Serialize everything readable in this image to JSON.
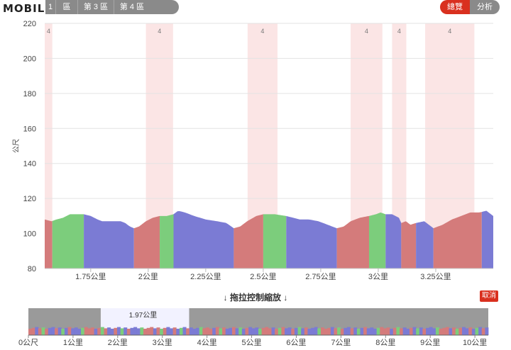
{
  "header": {
    "logo_text": "MOBILE",
    "logo_icon": "smiley-face-icon",
    "zone_tabs": [
      {
        "label": "1",
        "width": 14
      },
      {
        "label": "區",
        "width": 30
      },
      {
        "label": "第 3 區",
        "width": 50
      },
      {
        "label": "第 4 區",
        "width": 50
      }
    ],
    "view_toggle": {
      "overview_label": "總覽",
      "analysis_label": "分析",
      "active": "overview"
    }
  },
  "chart_data": [
    {
      "type": "area",
      "ylabel": "公尺",
      "ylim": [
        80,
        220
      ],
      "xlim": [
        1.55,
        3.5
      ],
      "y_ticks": [
        80,
        100,
        120,
        140,
        160,
        180,
        200,
        220
      ],
      "x_ticks": [
        1.75,
        2.0,
        2.25,
        2.5,
        2.75,
        3.0,
        3.25
      ],
      "x_tick_labels": [
        "1.75公里",
        "2公里",
        "2.25公里",
        "2.5公里",
        "2.75公里",
        "3公里",
        "3.25公里"
      ],
      "grid": true,
      "colors": {
        "red": "#d47b7b",
        "green": "#7ccd7c",
        "blue": "#7b7bd4"
      },
      "zone_bands": [
        {
          "x0": 1.55,
          "x1": 1.583,
          "label": "4"
        },
        {
          "x0": 1.99,
          "x1": 2.108,
          "label": "4"
        },
        {
          "x0": 2.432,
          "x1": 2.562,
          "label": "4"
        },
        {
          "x0": 2.88,
          "x1": 3.018,
          "label": "4"
        },
        {
          "x0": 3.06,
          "x1": 3.122,
          "label": "4"
        },
        {
          "x0": 3.204,
          "x1": 3.418,
          "label": "4"
        }
      ],
      "segments": [
        {
          "x0": 1.55,
          "x1": 1.583,
          "color": "red"
        },
        {
          "x0": 1.583,
          "x1": 1.72,
          "color": "green"
        },
        {
          "x0": 1.72,
          "x1": 1.938,
          "color": "blue"
        },
        {
          "x0": 1.938,
          "x1": 2.05,
          "color": "red"
        },
        {
          "x0": 2.05,
          "x1": 2.11,
          "color": "green"
        },
        {
          "x0": 2.11,
          "x1": 2.372,
          "color": "blue"
        },
        {
          "x0": 2.372,
          "x1": 2.5,
          "color": "red"
        },
        {
          "x0": 2.5,
          "x1": 2.6,
          "color": "green"
        },
        {
          "x0": 2.6,
          "x1": 2.82,
          "color": "blue"
        },
        {
          "x0": 2.82,
          "x1": 2.96,
          "color": "red"
        },
        {
          "x0": 2.96,
          "x1": 3.032,
          "color": "green"
        },
        {
          "x0": 3.032,
          "x1": 3.1,
          "color": "blue"
        },
        {
          "x0": 3.1,
          "x1": 3.164,
          "color": "red"
        },
        {
          "x0": 3.164,
          "x1": 3.24,
          "color": "blue"
        },
        {
          "x0": 3.24,
          "x1": 3.45,
          "color": "red"
        },
        {
          "x0": 3.45,
          "x1": 3.5,
          "color": "blue"
        }
      ],
      "elevation": {
        "x": [
          1.55,
          1.58,
          1.6,
          1.63,
          1.66,
          1.7,
          1.72,
          1.75,
          1.78,
          1.8,
          1.82,
          1.85,
          1.88,
          1.9,
          1.92,
          1.938,
          1.96,
          1.99,
          2.02,
          2.05,
          2.08,
          2.11,
          2.13,
          2.16,
          2.2,
          2.25,
          2.3,
          2.34,
          2.372,
          2.4,
          2.43,
          2.47,
          2.5,
          2.55,
          2.6,
          2.63,
          2.66,
          2.7,
          2.74,
          2.78,
          2.82,
          2.85,
          2.88,
          2.92,
          2.96,
          2.99,
          3.01,
          3.032,
          3.06,
          3.09,
          3.1,
          3.12,
          3.14,
          3.164,
          3.2,
          3.24,
          3.28,
          3.32,
          3.36,
          3.4,
          3.44,
          3.47,
          3.5
        ],
        "y": [
          108,
          107,
          108,
          109,
          111,
          111,
          111,
          110,
          108,
          107,
          107,
          107,
          107,
          106,
          104,
          103,
          104,
          107,
          109,
          110,
          110,
          111,
          113,
          112,
          110,
          108,
          107,
          106,
          103,
          104,
          107,
          110,
          111,
          111,
          110,
          109,
          108,
          108,
          107,
          105,
          103,
          104,
          107,
          109,
          110,
          111,
          112,
          111,
          111,
          109,
          106,
          107,
          105,
          106,
          107,
          103,
          105,
          108,
          110,
          112,
          112,
          113,
          110
        ]
      }
    },
    {
      "type": "area",
      "xlim": [
        0,
        10.3
      ],
      "x_ticks": [
        0,
        1,
        2,
        3,
        4,
        5,
        6,
        7,
        8,
        9,
        10
      ],
      "x_tick_labels": [
        "0公尺",
        "1公里",
        "2公里",
        "3公里",
        "4公里",
        "5公里",
        "6公里",
        "7公里",
        "8公里",
        "9公里",
        "10公里"
      ],
      "selection": {
        "x0": 1.62,
        "x1": 3.6,
        "label": "1.97公里"
      },
      "color_cycle": [
        "red",
        "green",
        "blue",
        "blue",
        "red",
        "green",
        "blue",
        "red",
        "blue",
        "green",
        "red",
        "blue"
      ],
      "colors": {
        "red": "#d47b7b",
        "green": "#7ccd7c",
        "blue": "#7b7bd4"
      }
    }
  ],
  "navigator": {
    "hint_text": "↓ 拖拉控制縮放 ↓",
    "cancel_label": "取消"
  }
}
